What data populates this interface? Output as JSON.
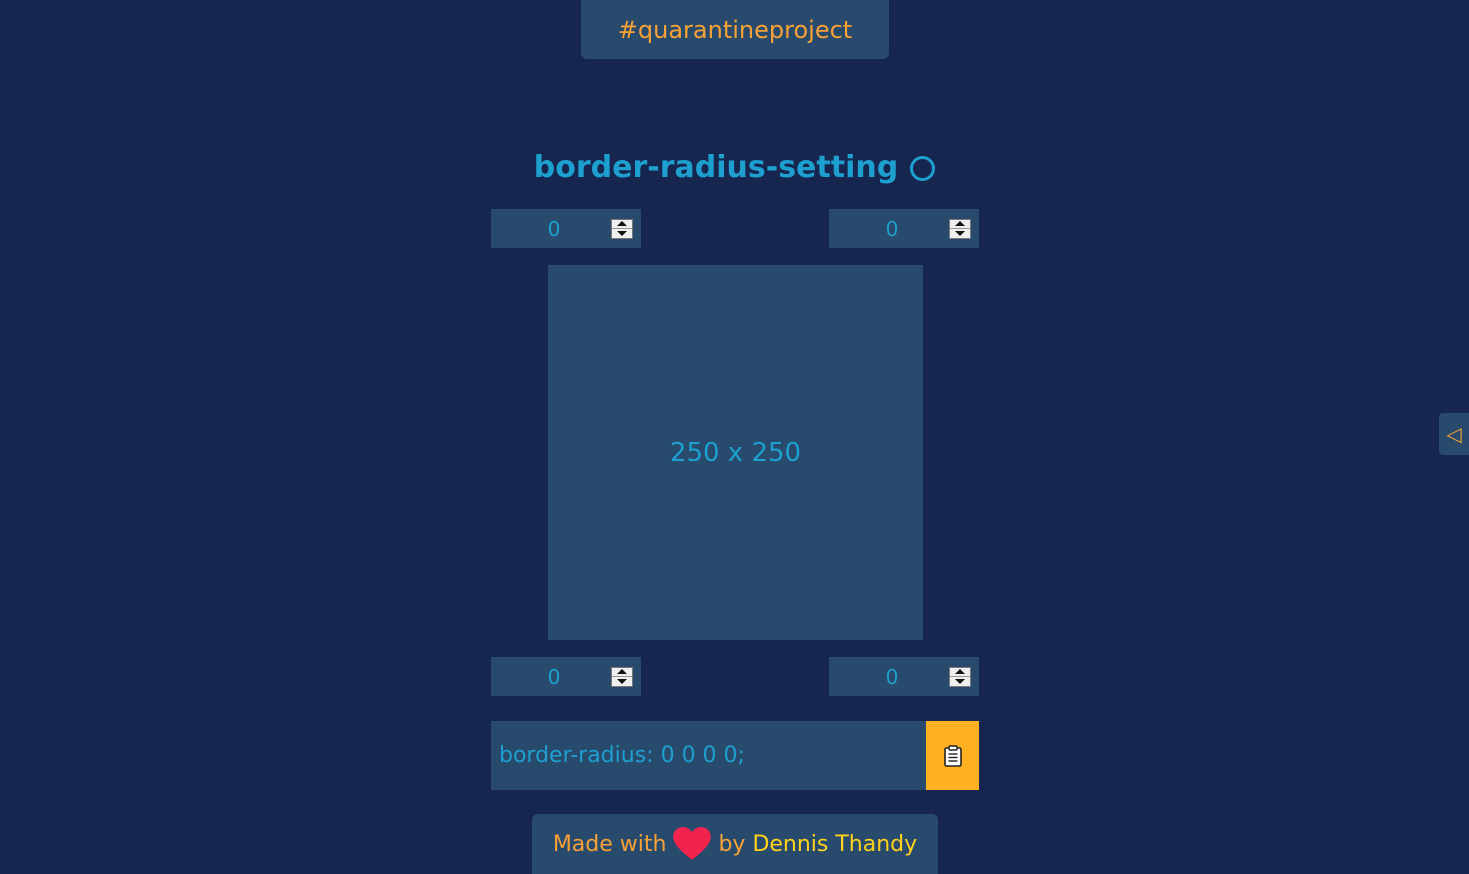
{
  "header": {
    "tag": "#quarantineproject"
  },
  "title": {
    "text": "border-radius-setting"
  },
  "fields": {
    "top_left": "0",
    "top_right": "0",
    "bottom_left": "0",
    "bottom_right": "0"
  },
  "preview": {
    "label": "250 x 250"
  },
  "output": {
    "code": "border-radius: 0 0 0 0;"
  },
  "footer": {
    "made_with": "Made with",
    "by": "by",
    "author": "Dennis Thandy"
  },
  "side_tab": {
    "glyph": "◁"
  },
  "colors": {
    "background": "#16264e",
    "panel": "#284a6c",
    "accent_blue": "#1d9fcf",
    "accent_orange": "#f7a136",
    "accent_yellow": "#ffd21c",
    "copy_button": "#ffb121",
    "heart": "#f2234d"
  },
  "icons": {
    "title_icon": "circle-icon",
    "copy_icon": "clipboard-icon",
    "heart_icon": "heart-icon",
    "side_tab_icon": "triangle-left-icon"
  }
}
